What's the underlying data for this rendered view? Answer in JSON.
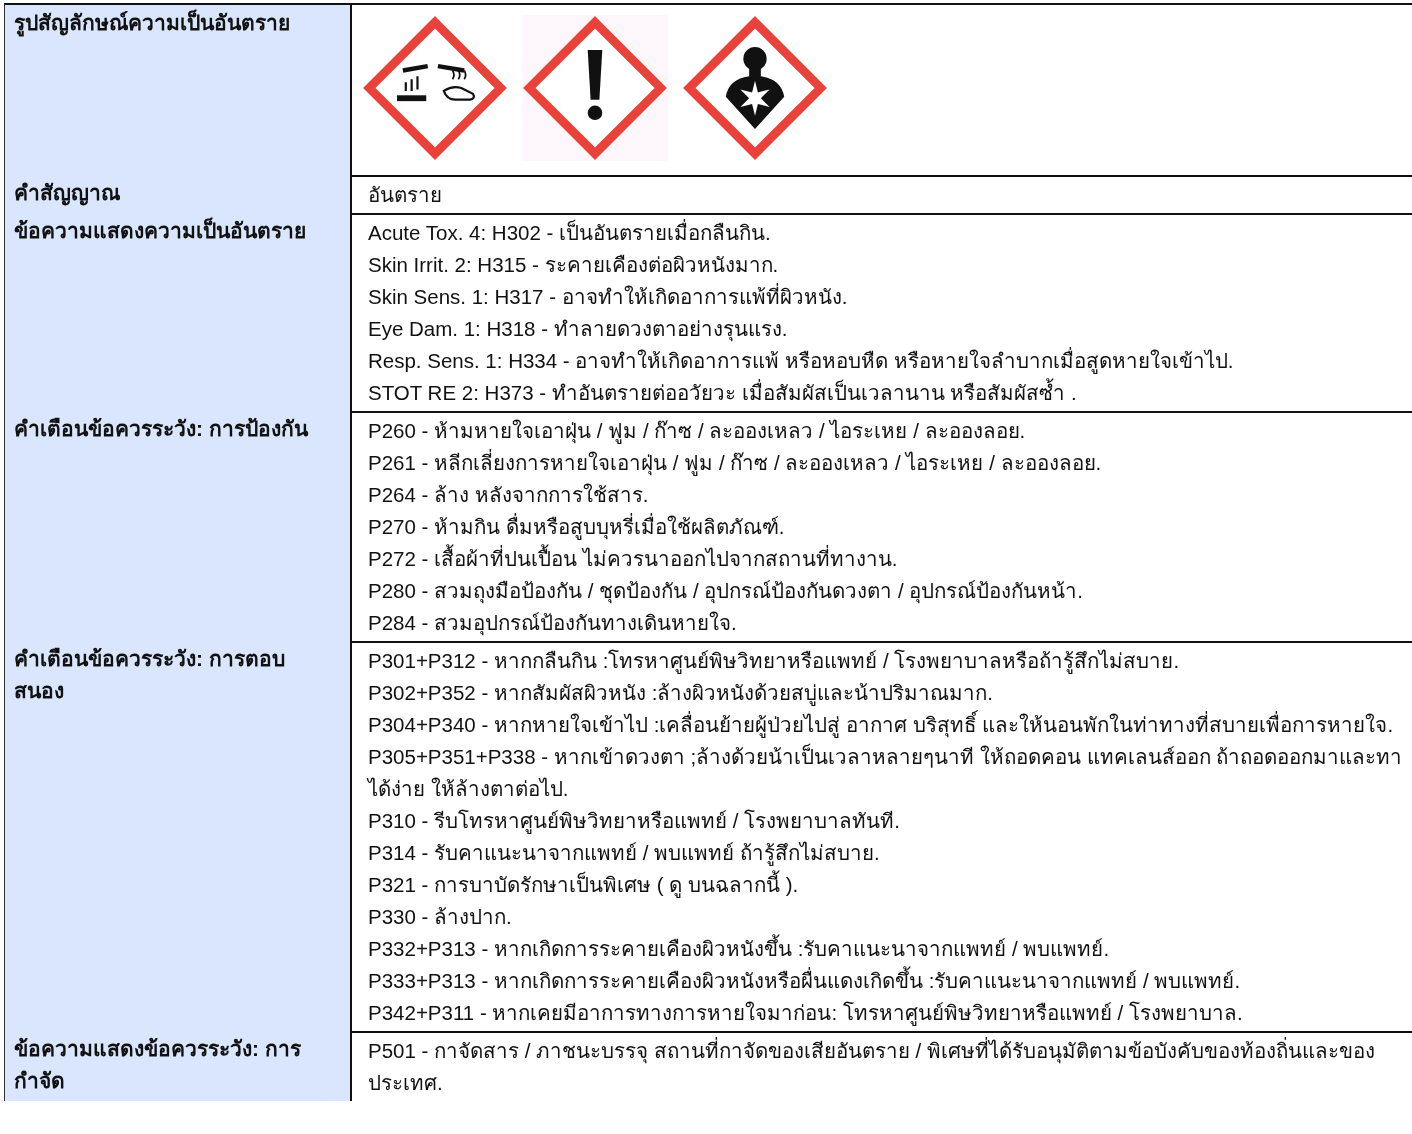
{
  "rows": [
    {
      "label": "รูปสัญลักษณ์ความเป็นอันตราย",
      "kind": "pictograms"
    },
    {
      "label": "คำสัญญาณ",
      "kind": "text",
      "lines": [
        "อันตราย"
      ]
    },
    {
      "label": "ข้อความแสดงความเป็นอันตราย",
      "kind": "text",
      "lines": [
        "Acute Tox. 4: H302 - เป็นอันตรายเมื่อกลืนกิน.",
        "Skin Irrit. 2: H315 - ระคายเคืองต่อผิวหนังมาก.",
        "Skin Sens. 1: H317 - อาจทำให้เกิดอาการแพ้ที่ผิวหนัง.",
        "Eye Dam. 1: H318 - ทำลายดวงตาอย่างรุนแรง.",
        "Resp. Sens. 1: H334 - อาจทำให้เกิดอาการแพ้ หรือหอบหืด หรือหายใจลำบากเมื่อสูดหายใจเข้าไป.",
        "STOT RE 2: H373 - ทำอันตรายต่ออวัยวะ  เมื่อสัมผัสเป็นเวลานาน หรือสัมผัสซ้ำ ."
      ]
    },
    {
      "label": "คำเตือนข้อควรระวัง: การป้องกัน",
      "kind": "text",
      "lines": [
        "P260 - ห้ามหายใจเอาฝุ่น / ฟูม / ก๊าซ / ละอองเหลว / ไอระเหย / ละอองลอย.",
        "P261 - หลีกเลี่ยงการหายใจเอาฝุ่น / ฟูม / ก๊าซ / ละอองเหลว / ไอระเหย / ละอองลอย.",
        "P264 - ล้าง  หลังจากการใช้สาร.",
        "P270 - ห้ามกิน ดื่มหรือสูบบุหรี่เมื่อใช้ผลิตภัณฑ์.",
        "P272 - เสื้อผ้าที่ปนเปื้อน ไม่ควรนาออกไปจากสถานที่ทางาน.",
        "P280 - สวมถุงมือป้องกัน / ชุดป้องกัน / อุปกรณ์ป้องกันดวงตา / อุปกรณ์ป้องกันหน้า.",
        "P284 - สวมอุปกรณ์ป้องกันทางเดินหายใจ."
      ]
    },
    {
      "label": "คำเตือนข้อควรระวัง: การตอบสนอง",
      "kind": "text",
      "lines": [
        "P301+P312 - หากกลืนกิน :โทรหาศูนย์พิษวิทยาหรือแพทย์ / โรงพยาบาลหรือถ้ารู้สึกไม่สบาย.",
        "P302+P352 - หากสัมผัสผิวหนัง :ล้างผิวหนังด้วยสบู่และน้าปริมาณมาก.",
        "P304+P340 - หากหายใจเข้าไป :เคลื่อนย้ายผู้ป่วยไปสู่ อากาศ บริสุทธิ์ และให้นอนพักในท่าทางที่สบายเพื่อการหายใจ.",
        "P305+P351+P338 - หากเข้าดวงตา ;ล้างด้วยน้าเป็นเวลาหลายๆนาที ให้ถอดคอน แทคเลนส์ออก ถ้าถอดออกมาและทาได้ง่าย ให้ล้างตาต่อไป.",
        "P310 - รีบโทรหาศูนย์พิษวิทยาหรือแพทย์ / โรงพยาบาลทันที.",
        "P314 - รับคาแนะนาจากแพทย์ / พบแพทย์ ถ้ารู้สึกไม่สบาย.",
        "P321 - การบาบัดรักษาเป็นพิเศษ ( ดู  บนฉลากนี้ ).",
        "P330 - ล้างปาก.",
        "P332+P313 - หากเกิดการระคายเคืองผิวหนังขึ้น :รับคาแนะนาจากแพทย์ / พบแพทย์.",
        "P333+P313 - หากเกิดการระคายเคืองผิวหนังหรือผื่นแดงเกิดขึ้น :รับคาแนะนาจากแพทย์ / พบแพทย์.",
        "P342+P311 - หากเคยมีอาการทางการหายใจมาก่อน: โทรหาศูนย์พิษวิทยาหรือแพทย์ / โรงพยาบาล."
      ]
    },
    {
      "label": "ข้อความแสดงข้อควรระวัง: การกำจัด",
      "kind": "text",
      "lines": [
        "P501 - กาจัดสาร / ภาชนะบรรจุ สถานที่กาจัดของเสียอันตราย / พิเศษที่ได้รับอนุมัติตามข้อบังคับของท้องถิ่นและของประเทศ."
      ]
    }
  ]
}
